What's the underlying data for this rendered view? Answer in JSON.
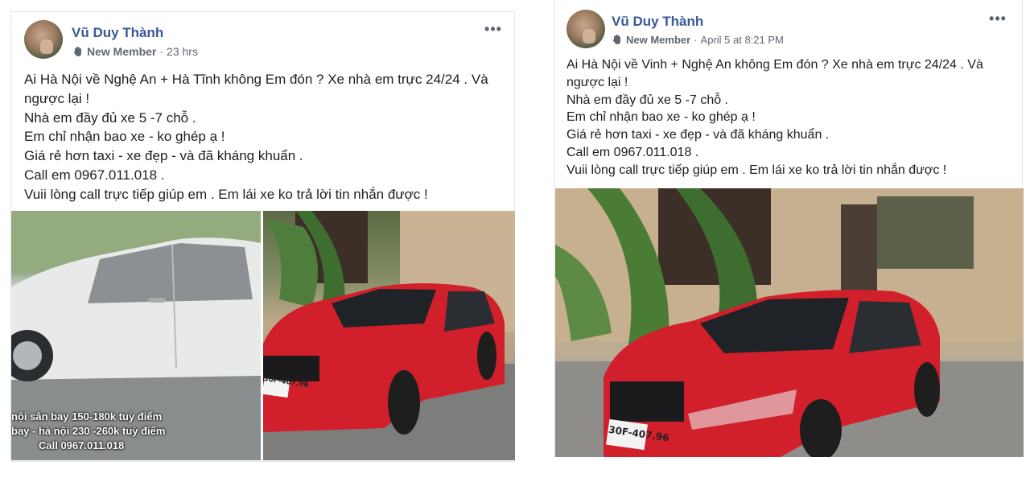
{
  "posts": [
    {
      "author": "Vũ Duy Thành",
      "badge": "New Member",
      "time": "23 hrs",
      "more_icon": "•••",
      "lines": [
        "Ai Hà Nội về Nghệ An + Hà Tĩnh không Em đón ? Xe nhà em trực 24/24 . Và",
        "ngược lại !",
        "Nhà em đầy đủ xe 5 -7 chỗ .",
        "Em chỉ nhận bao xe - ko ghép ạ !",
        "Giá rẻ hơn taxi - xe đẹp - và đã kháng khuẩn .",
        "Call em 0967.011.018 .",
        "Vuii lòng call trực tiếp giúp em . Em lái xe ko trả lời tin nhắn được !"
      ],
      "photo_overlay": [
        "nội sân bay 150-180k tuỳ điểm",
        "bay - hà nội 230 -260k tuỳ điểm",
        "Call 0967.011.018"
      ],
      "plate": "30F-407.96"
    },
    {
      "author": "Vũ Duy Thành",
      "badge": "New Member",
      "time": "April 5 at 8:21 PM",
      "more_icon": "•••",
      "lines": [
        "Ai Hà Nội về Vinh + Nghệ An không Em đón ? Xe nhà em trực 24/24 . Và",
        "ngược lại !",
        "Nhà em đầy đủ xe 5 -7 chỗ .",
        "Em chỉ nhận bao xe - ko ghép ạ !",
        "Giá rẻ hơn taxi - xe đẹp - và đã kháng khuẩn .",
        "Call em 0967.011.018 .",
        "Vuii lòng call trực tiếp giúp em . Em lái xe ko trả lời tin nhắn được !"
      ],
      "plate": "30F-407.96"
    }
  ],
  "icons": {
    "badge": "new-member-hand-icon",
    "more": "more-options-icon",
    "avatar": "avatar"
  },
  "colors": {
    "name": "#385898",
    "meta": "#606770",
    "text": "#1c1e21",
    "car_red": "#d1202b",
    "car_white": "#e9ebee"
  }
}
